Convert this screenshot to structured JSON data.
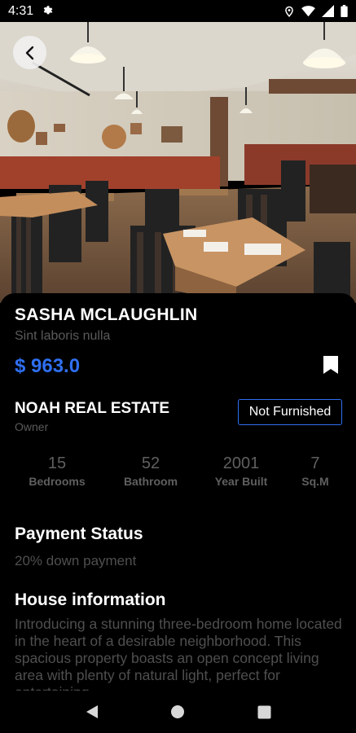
{
  "status_bar": {
    "time": "4:31",
    "icons": [
      "settings-gear-icon",
      "location-icon",
      "wifi-icon",
      "signal-icon",
      "battery-icon"
    ]
  },
  "listing": {
    "title": "SASHA MCLAUGHLIN",
    "subtitle": "Sint laboris nulla",
    "price": "$ 963.0",
    "agency": "NOAH REAL ESTATE",
    "role": "Owner",
    "furnishing": "Not Furnished"
  },
  "stats": [
    {
      "value": "15",
      "label": "Bedrooms"
    },
    {
      "value": "52",
      "label": "Bathroom"
    },
    {
      "value": "2001",
      "label": "Year Built"
    },
    {
      "value": "7",
      "label": "Sq.M"
    }
  ],
  "payment": {
    "heading": "Payment Status",
    "text": "20% down payment"
  },
  "house_info": {
    "heading": "House information",
    "text": "Introducing a stunning three-bedroom home located in the heart of a desirable neighborhood. This spacious property boasts an open concept living area with plenty of natural light, perfect for entertaining"
  },
  "colors": {
    "accent": "#2f6ff0",
    "background": "#000000",
    "muted_text": "#5a5a5a"
  },
  "nav": [
    "back-triangle-icon",
    "home-circle-icon",
    "recents-square-icon"
  ]
}
